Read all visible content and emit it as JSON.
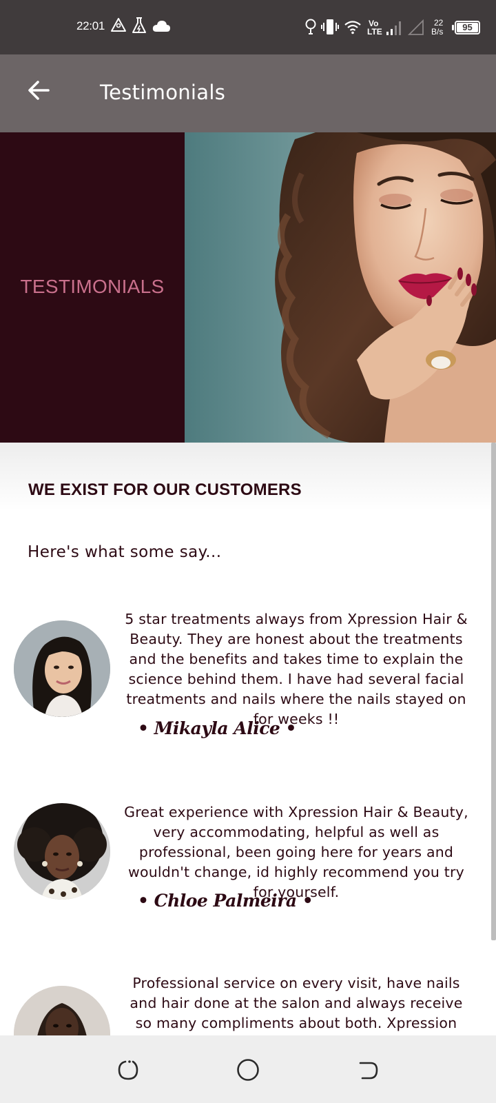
{
  "status_bar": {
    "time": "22:01",
    "network_speed_value": "22",
    "network_speed_unit": "B/s",
    "battery": "95",
    "volte_top": "Vo",
    "volte_bottom": "LTE"
  },
  "app_bar": {
    "title": "Testimonials",
    "back_icon": "arrow-left-icon"
  },
  "banner": {
    "label": "TESTIMONIALS",
    "left_color": "#2d0a14",
    "label_color": "#c9708c"
  },
  "content": {
    "heading": "WE EXIST FOR OUR CUSTOMERS",
    "subheading": "Here's what some say..."
  },
  "testimonials": [
    {
      "quote": "5 star treatments always from Xpression Hair & Beauty. They are honest about the treatments and the benefits and takes time to explain the science behind them. I have had several facial treatments and nails where the nails stayed on for weeks !!",
      "author": "• Mikayla Alice •"
    },
    {
      "quote": "Great experience with Xpression Hair & Beauty, very accommodating, helpful as well as professional, been going here for years and wouldn't change, id highly recommend you try for yourself.",
      "author": "• Chloe Palmeira •"
    },
    {
      "quote": "Professional service on every visit, have nails and hair done at the salon and always receive so many compliments about both. Xpression",
      "author": ""
    }
  ],
  "nav_bar": {
    "back_icon": "rotate-back-icon",
    "home_icon": "circle-home-icon",
    "recents_icon": "rotate-recents-icon"
  },
  "colors": {
    "status_bar": "#403b3c",
    "app_bar": "#6c6566",
    "text_primary": "#2d0a14",
    "nav_bar": "#eeeeee"
  }
}
